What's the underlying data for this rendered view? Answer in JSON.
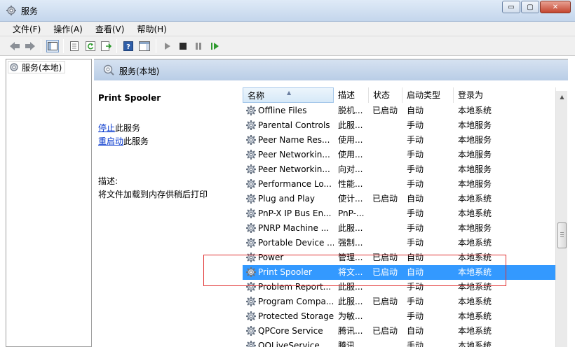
{
  "window": {
    "title": "服务",
    "buttons": [
      "▭",
      "▢",
      "✕"
    ]
  },
  "menu": [
    "文件(F)",
    "操作(A)",
    "查看(V)",
    "帮助(H)"
  ],
  "tree": {
    "node": "服务(本地)"
  },
  "pane": {
    "header": "服务(本地)"
  },
  "details": {
    "service_name": "Print Spooler",
    "action_stop_link": "停止",
    "action_stop_text": "此服务",
    "action_restart_link": "重启动",
    "action_restart_text": "此服务",
    "desc_label": "描述:",
    "desc_text": "将文件加载到内存供稍后打印"
  },
  "table": {
    "columns": [
      "名称",
      "描述",
      "状态",
      "启动类型",
      "登录为"
    ],
    "rows": [
      [
        "Offline Files",
        "脱机...",
        "已启动",
        "自动",
        "本地系统"
      ],
      [
        "Parental Controls",
        "此服...",
        "",
        "手动",
        "本地服务"
      ],
      [
        "Peer Name Res...",
        "使用...",
        "",
        "手动",
        "本地服务"
      ],
      [
        "Peer Networkin...",
        "使用...",
        "",
        "手动",
        "本地服务"
      ],
      [
        "Peer Networkin...",
        "向对...",
        "",
        "手动",
        "本地服务"
      ],
      [
        "Performance Lo...",
        "性能...",
        "",
        "手动",
        "本地服务"
      ],
      [
        "Plug and Play",
        "使计...",
        "已启动",
        "自动",
        "本地系统"
      ],
      [
        "PnP-X IP Bus En...",
        "PnP-...",
        "",
        "手动",
        "本地系统"
      ],
      [
        "PNRP Machine ...",
        "此服...",
        "",
        "手动",
        "本地服务"
      ],
      [
        "Portable Device ...",
        "强制...",
        "",
        "手动",
        "本地系统"
      ],
      [
        "Power",
        "管理...",
        "已启动",
        "自动",
        "本地系统"
      ],
      [
        "Print Spooler",
        "将文...",
        "已启动",
        "自动",
        "本地系统"
      ],
      [
        "Problem Report...",
        "此服...",
        "",
        "手动",
        "本地系统"
      ],
      [
        "Program Compa...",
        "此服...",
        "已启动",
        "手动",
        "本地系统"
      ],
      [
        "Protected Storage",
        "为敏...",
        "",
        "手动",
        "本地系统"
      ],
      [
        "QPCore Service",
        "腾讯...",
        "已启动",
        "自动",
        "本地系统"
      ],
      [
        "QQLiveService",
        "腾讯...",
        "",
        "手动",
        "本地系统"
      ]
    ],
    "selected_index": 11
  },
  "colors": {
    "selection": "#3399ff",
    "highlight_box": "#e03030",
    "link": "#0033cc"
  }
}
